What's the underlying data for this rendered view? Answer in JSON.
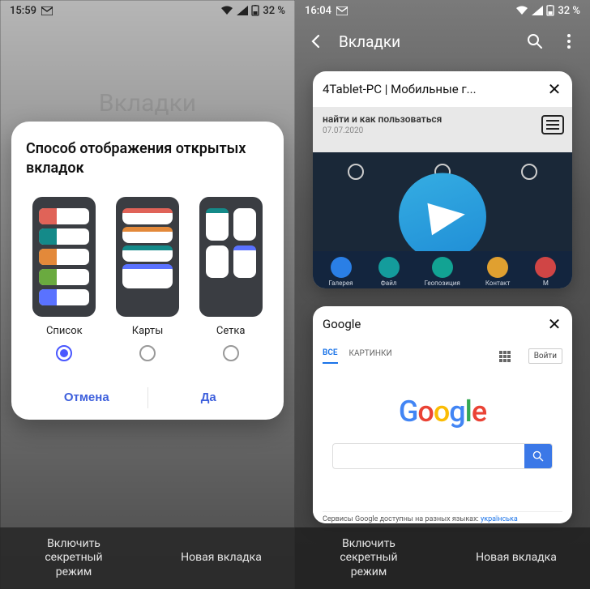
{
  "left": {
    "status": {
      "time": "15:59",
      "battery": "32 %"
    },
    "dimmed_title": "Вкладки",
    "dialog": {
      "title": "Способ отображения открытых вкладок",
      "options": [
        {
          "label": "Список",
          "selected": true
        },
        {
          "label": "Карты",
          "selected": false
        },
        {
          "label": "Сетка",
          "selected": false
        }
      ],
      "cancel": "Отмена",
      "ok": "Да"
    },
    "bottom": {
      "secret": "Включить\nсекретный\nрежим",
      "newtab": "Новая вкладка"
    }
  },
  "right": {
    "status": {
      "time": "16:04",
      "battery": "32 %"
    },
    "appbar": {
      "title": "Вкладки"
    },
    "tabs": [
      {
        "title": "4Tablet-PC | Мобильные г...",
        "preview": {
          "subtitle": "найти и как пользоваться",
          "date": "07.07.2020",
          "bottom_items": [
            "Галерея",
            "Файл",
            "Геопозиция",
            "Контакт",
            "М"
          ]
        }
      },
      {
        "title": "Google",
        "preview": {
          "tabs": {
            "all": "ВСЕ",
            "images": "КАРТИНКИ"
          },
          "signin": "Войти",
          "footer": "Сервисы Google доступны на разных языках:",
          "footer_lang": "українська"
        }
      }
    ],
    "bottom": {
      "secret": "Включить\nсекретный\nрежим",
      "newtab": "Новая вкладка"
    }
  }
}
